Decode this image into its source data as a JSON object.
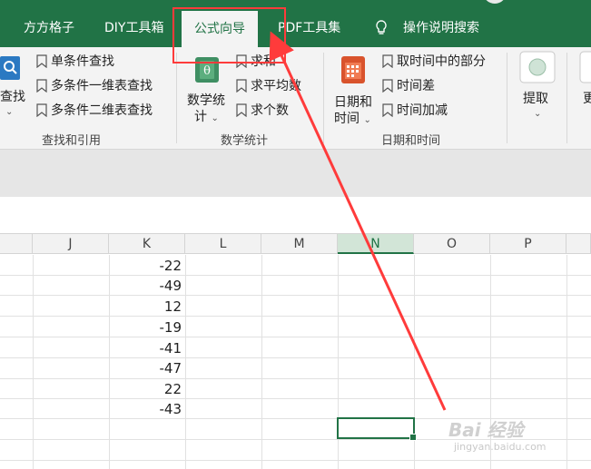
{
  "tabs": [
    {
      "label": "方方格子"
    },
    {
      "label": "DIY工具箱"
    },
    {
      "label": "公式向导",
      "active": true
    },
    {
      "label": "PDF工具集"
    },
    {
      "label": "操作说明搜索"
    }
  ],
  "ribbon": {
    "lookup_group": {
      "big_button_label": "查找",
      "items": [
        "单条件查找",
        "多条件一维表查找",
        "多条件二维表查找"
      ],
      "group_label": "查找和引用"
    },
    "math_group": {
      "big_button_label_1": "数学统",
      "big_button_label_2": "计",
      "items": [
        "求和",
        "求平均数",
        "求个数"
      ],
      "group_label": "数学统计"
    },
    "datetime_group": {
      "big_button_label_1": "日期和",
      "big_button_label_2": "时间",
      "items": [
        "取时间中的部分",
        "时间差",
        "时间加减"
      ],
      "group_label": "日期和时间"
    },
    "extract_group": {
      "big_button_label": "提取",
      "next_label": "更"
    }
  },
  "grid": {
    "columns": [
      "J",
      "K",
      "L",
      "M",
      "N",
      "O",
      "P"
    ],
    "active_column": "N",
    "k_values": [
      "-22",
      "-49",
      "12",
      "-19",
      "-41",
      "-47",
      "22",
      "-43"
    ]
  },
  "watermark": {
    "text": "Bai 经验",
    "sub": "jingyan.baidu.com"
  },
  "colors": {
    "ribbon_green": "#217346",
    "annotation_red": "#ff3b3b"
  },
  "icons": [
    "bookmark-icon",
    "lookup-icon",
    "math-icon",
    "calendar-icon",
    "lightbulb-icon",
    "extract-icon",
    "chevron-down-icon"
  ]
}
